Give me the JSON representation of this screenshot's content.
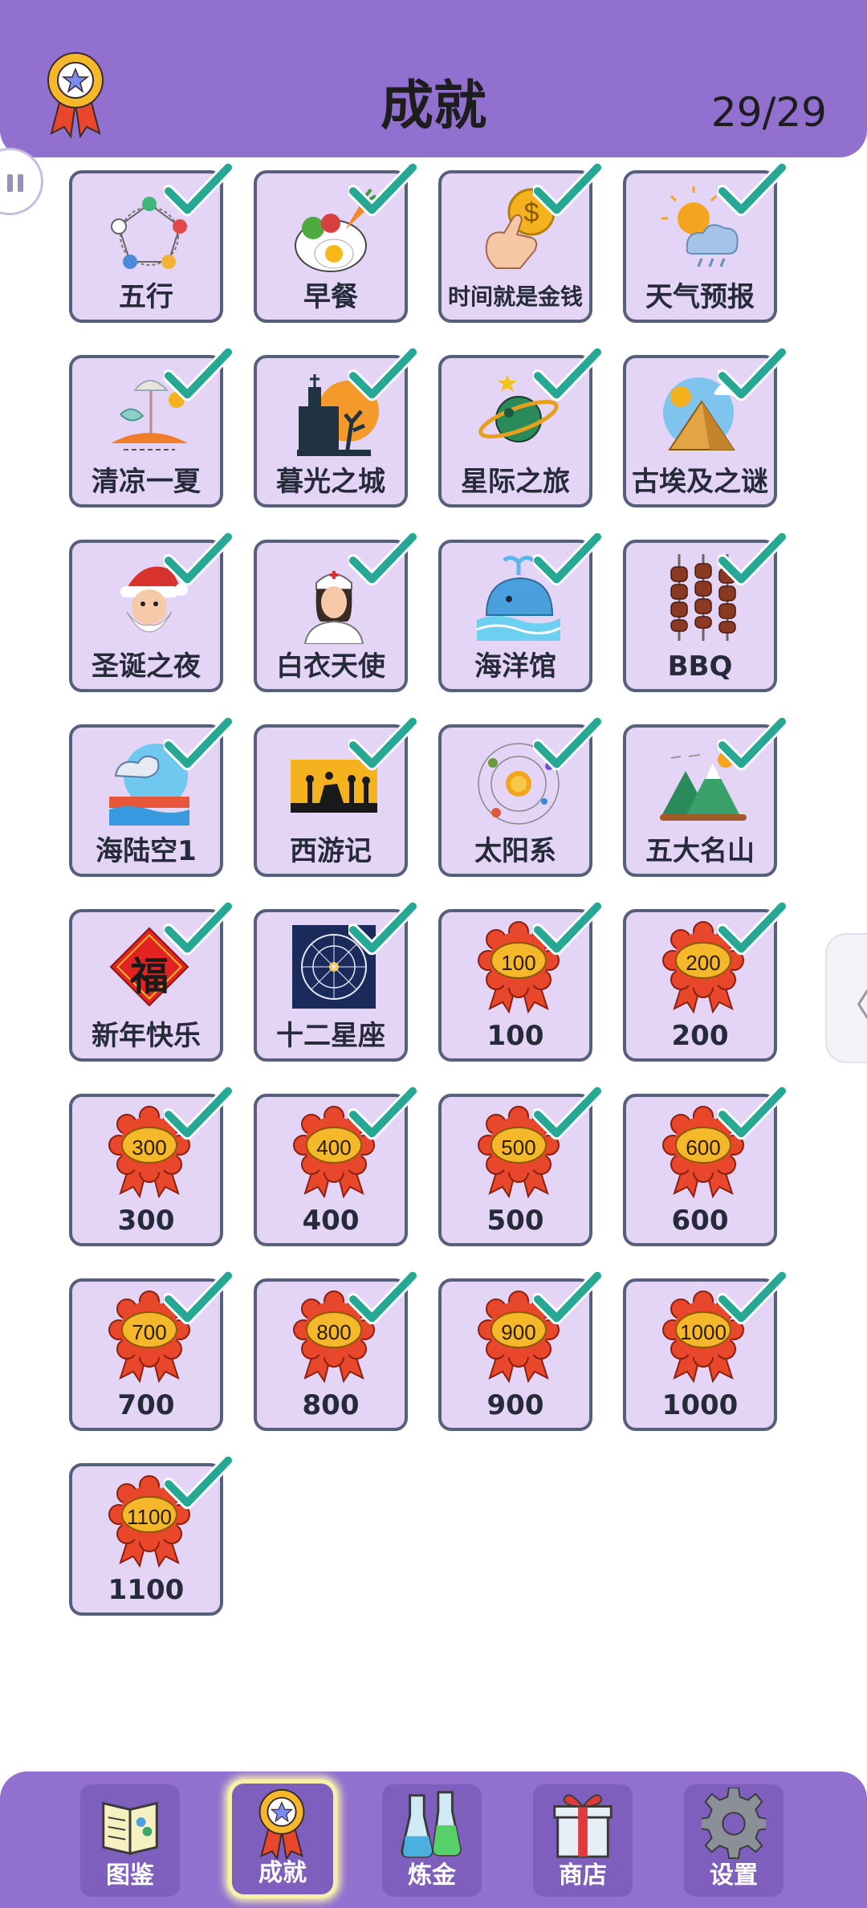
{
  "header": {
    "title": "成就",
    "count": "29/29",
    "icon": "medal-icon"
  },
  "achievements": [
    {
      "label": "五行",
      "icon": "five-elements-icon"
    },
    {
      "label": "早餐",
      "icon": "breakfast-icon"
    },
    {
      "label": "时间就是金钱",
      "icon": "time-is-money-icon"
    },
    {
      "label": "天气预报",
      "icon": "weather-icon"
    },
    {
      "label": "清凉一夏",
      "icon": "summer-beach-icon"
    },
    {
      "label": "暮光之城",
      "icon": "twilight-castle-icon"
    },
    {
      "label": "星际之旅",
      "icon": "planet-icon"
    },
    {
      "label": "古埃及之谜",
      "icon": "pyramid-icon"
    },
    {
      "label": "圣诞之夜",
      "icon": "santa-icon"
    },
    {
      "label": "白衣天使",
      "icon": "nurse-icon"
    },
    {
      "label": "海洋馆",
      "icon": "whale-icon"
    },
    {
      "label": "BBQ",
      "icon": "skewers-icon"
    },
    {
      "label": "海陆空1",
      "icon": "sea-land-sky-icon"
    },
    {
      "label": "西游记",
      "icon": "journey-west-icon"
    },
    {
      "label": "太阳系",
      "icon": "solar-system-icon"
    },
    {
      "label": "五大名山",
      "icon": "mountains-icon"
    },
    {
      "label": "新年快乐",
      "icon": "fu-icon",
      "glyph": "福"
    },
    {
      "label": "十二星座",
      "icon": "zodiac-icon"
    },
    {
      "label": "100",
      "icon": "rosette-icon",
      "badge": "100"
    },
    {
      "label": "200",
      "icon": "rosette-icon",
      "badge": "200"
    },
    {
      "label": "300",
      "icon": "rosette-icon",
      "badge": "300"
    },
    {
      "label": "400",
      "icon": "rosette-icon",
      "badge": "400"
    },
    {
      "label": "500",
      "icon": "rosette-icon",
      "badge": "500"
    },
    {
      "label": "600",
      "icon": "rosette-icon",
      "badge": "600"
    },
    {
      "label": "700",
      "icon": "rosette-icon",
      "badge": "700"
    },
    {
      "label": "800",
      "icon": "rosette-icon",
      "badge": "800"
    },
    {
      "label": "900",
      "icon": "rosette-icon",
      "badge": "900"
    },
    {
      "label": "1000",
      "icon": "rosette-icon",
      "badge": "1000"
    },
    {
      "label": "1100",
      "icon": "rosette-icon",
      "badge": "1100"
    }
  ],
  "nav": [
    {
      "label": "图鉴",
      "icon": "book-icon"
    },
    {
      "label": "成就",
      "icon": "medal-icon",
      "active": true
    },
    {
      "label": "炼金",
      "icon": "flask-icon"
    },
    {
      "label": "商店",
      "icon": "gift-icon"
    },
    {
      "label": "设置",
      "icon": "gear-icon"
    }
  ],
  "colors": {
    "header": "#9170cf",
    "card": "#e4d4f6",
    "card_border": "#56607a",
    "check": "#27a894",
    "ribbon": "#e8472b",
    "ribbon_center": "#f5b82a"
  }
}
